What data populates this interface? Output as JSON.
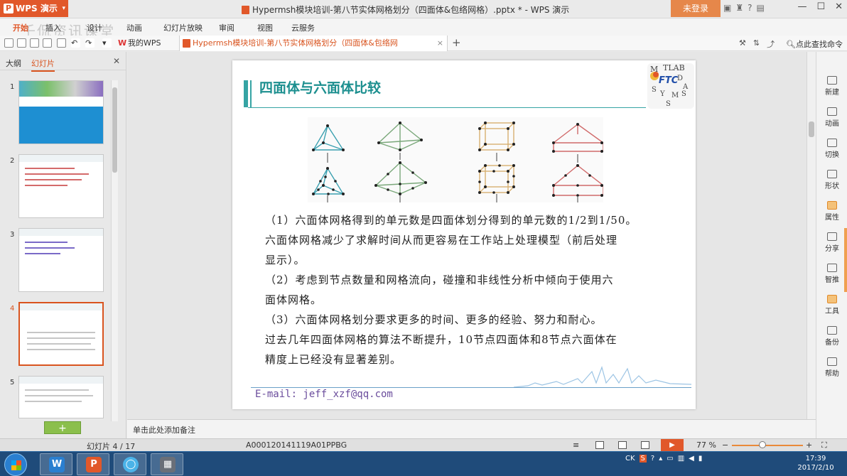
{
  "window": {
    "app_name": "WPS 演示",
    "doc_title": "Hypermsh模块培训-第八节实体网格划分（四面体&包络网格）.pptx * - WPS 演示",
    "login_label": "未登录"
  },
  "menu": {
    "tabs": [
      "开始",
      "插入",
      "设计",
      "动画",
      "幻灯片放映",
      "审阅",
      "视图",
      "云服务"
    ],
    "watermark": "壬侃资讯课堂"
  },
  "doc_tabs": {
    "wps_home": "我的WPS",
    "active_file": "Hypermsh模块培训-第八节实体网格划分（四面体&包络网格）.pptx *"
  },
  "toolbar": {
    "search_label": "点此查找命令"
  },
  "left_panel": {
    "tab_outline": "大纲",
    "tab_slides": "幻灯片",
    "slide_numbers": [
      "1",
      "2",
      "3",
      "4",
      "5"
    ]
  },
  "slide": {
    "title": "四面体与六面体比较",
    "logo_text": "MATLAB FTC",
    "paragraphs": [
      "（1）六面体网格得到的单元数是四面体划分得到的单元数的1/2到1/50。",
      "六面体网格减少了求解时间从而更容易在工作站上处理模型（前后处理",
      "显示）。",
      "（2）考虑到节点数量和网格流向，碰撞和非线性分析中倾向于使用六",
      "面体网格。",
      "（3）六面体网格划分要求更多的时间、更多的经验、努力和耐心。",
      "过去几年四面体网格的算法不断提升，10节点四面体和8节点六面体在",
      "精度上已经没有显著差别。"
    ],
    "email": "E-mail: jeff_xzf@qq.com"
  },
  "notes": {
    "placeholder": "单击此处添加备注"
  },
  "right_sidebar": {
    "items": [
      "新建",
      "动画",
      "切换",
      "形状",
      "属性",
      "分享",
      "智推",
      "工具",
      "备份",
      "帮助"
    ]
  },
  "status": {
    "slide_counter": "幻灯片 4 / 17",
    "file_code": "A000120141119A01PPBG",
    "zoom": "77 %"
  },
  "taskbar": {
    "lang": "CK",
    "time": "17:39",
    "date": "2017/2/10"
  },
  "colors": {
    "accent": "#e1582a",
    "title_teal": "#1c8f8f",
    "email_purple": "#6a4c9c"
  }
}
